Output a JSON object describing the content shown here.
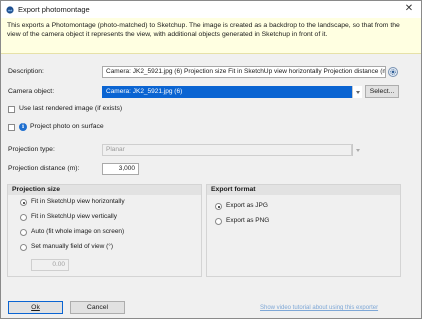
{
  "window": {
    "title": "Export photomontage",
    "close_glyph": "✕"
  },
  "banner": {
    "text": "This exports a Photomontage (photo-matched) to Sketchup. The image is created as a backdrop to the landscape, so that from the view of the camera object it represents the view, with additional objects generated in Sketchup in front of it."
  },
  "form": {
    "description_label": "Description:",
    "description_value": "Camera: JK2_5921.jpg (6) Projection size Fit in SketchUp view horizontally Projection distance (m",
    "camera_label": "Camera object:",
    "camera_value": "Camera: JK2_5921.jpg (6)",
    "select_button": "Select...",
    "use_last_rendered": "Use last rendered image (if exists)",
    "project_photo": "Project photo on surface",
    "projection_type_label": "Projection type:",
    "projection_type_value": "Planar",
    "projection_distance_label": "Projection distance (m):",
    "projection_distance_value": "3,000"
  },
  "projection_size": {
    "title": "Projection size",
    "options": [
      {
        "label": "Fit in SketchUp view horizontally",
        "selected": true
      },
      {
        "label": "Fit in SketchUp view vertically",
        "selected": false
      },
      {
        "label": "Auto (fit whole image on screen)",
        "selected": false
      },
      {
        "label": "Set manually field of view (°)",
        "selected": false
      }
    ],
    "fov_value": "0.00"
  },
  "export_format": {
    "title": "Export format",
    "options": [
      {
        "label": "Export as JPG",
        "selected": true
      },
      {
        "label": "Export as PNG",
        "selected": false
      }
    ]
  },
  "footer": {
    "ok_label": "Ok",
    "cancel_label": "Cancel",
    "tutorial_link": "Show video tutorial about using this exporter"
  },
  "colors": {
    "accent": "#0a64d2",
    "banner_bg": "#ffffe1",
    "info_icon": "#1f6fcf"
  }
}
